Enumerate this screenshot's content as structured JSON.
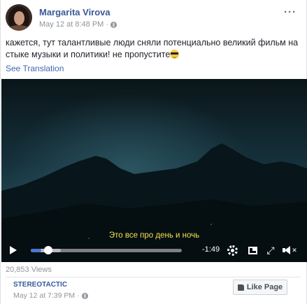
{
  "post": {
    "author": "Margarita Virova",
    "timestamp": "May 12 at 8:48 PM",
    "more_label": "···",
    "text": "кажется, тут талантливые люди сняли потенциально великий фильм на стыке музыки и политики! не пропустите",
    "see_translation": "See Translation"
  },
  "video": {
    "subtitle": "Это все про день и ночь",
    "time_remaining": "-1:49",
    "progress_fraction": 0.07,
    "buffered_fraction": 0.2,
    "accent_color": "#4a76d4"
  },
  "footer": {
    "views": "20,853 Views",
    "page_name": "STEREOTACTIC",
    "page_timestamp": "May 12 at 7:39 PM",
    "like_page_label": "Like Page"
  },
  "icons": [
    "globe-icon",
    "more-icon",
    "play-icon",
    "settings-icon",
    "pip-icon",
    "fullscreen-icon",
    "volume-icon",
    "thumbs-up-icon"
  ]
}
